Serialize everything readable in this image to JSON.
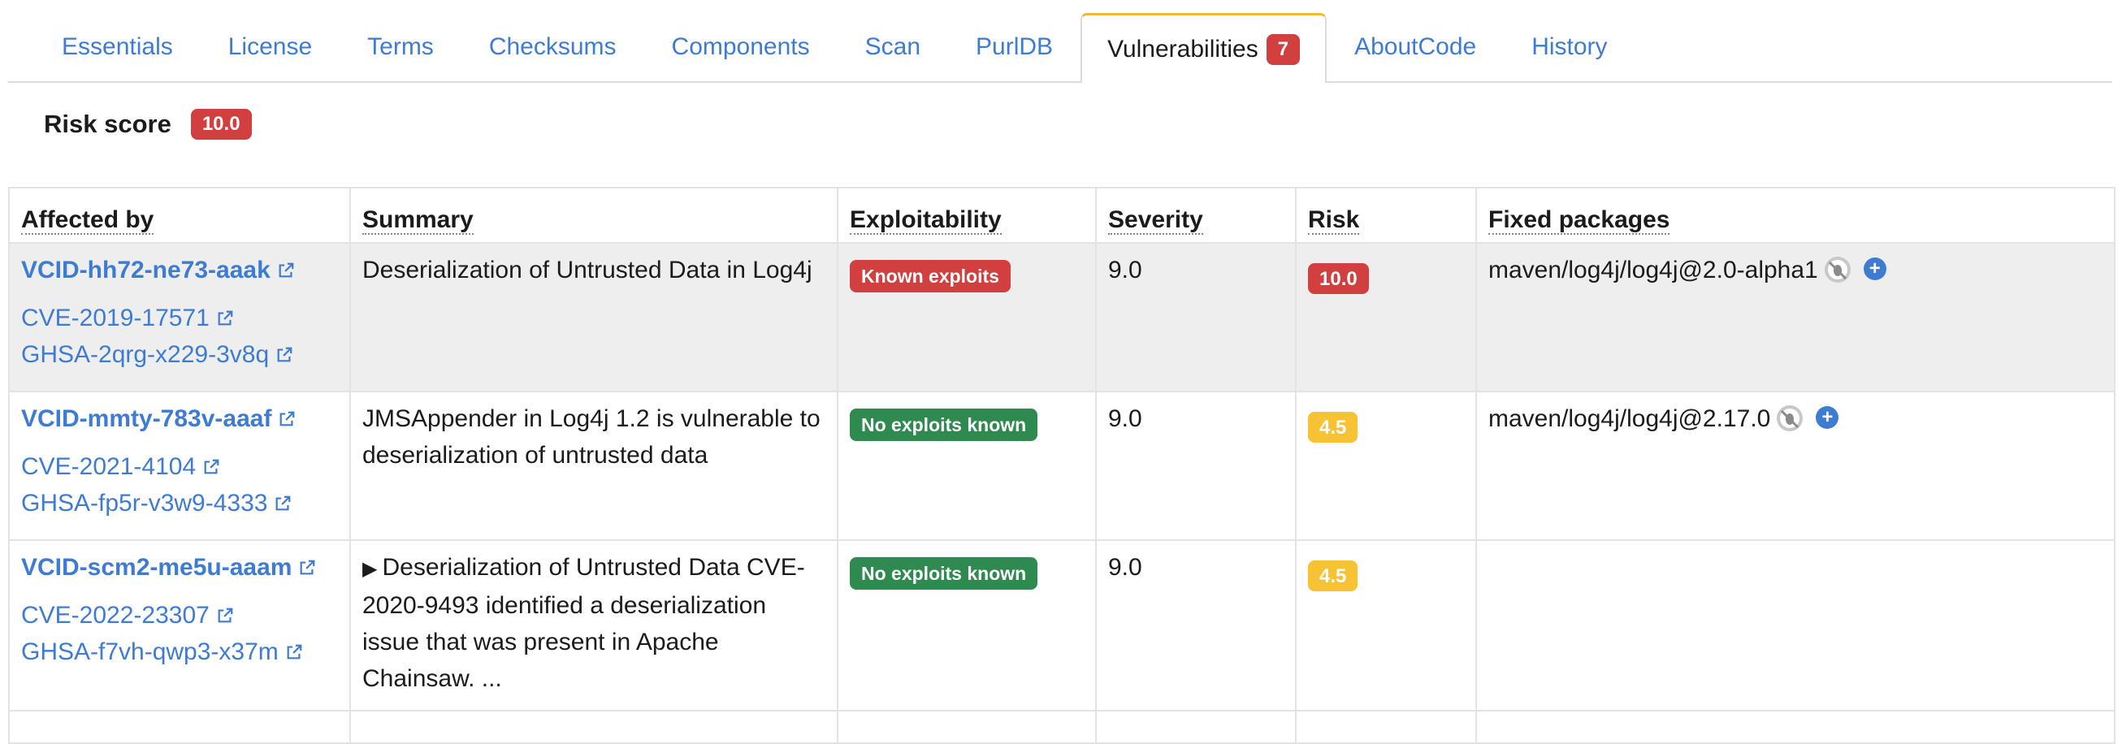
{
  "tabs": [
    {
      "label": "Essentials"
    },
    {
      "label": "License"
    },
    {
      "label": "Terms"
    },
    {
      "label": "Checksums"
    },
    {
      "label": "Components"
    },
    {
      "label": "Scan"
    },
    {
      "label": "PurlDB"
    },
    {
      "label": "Vulnerabilities",
      "badge": "7",
      "active": true
    },
    {
      "label": "AboutCode"
    },
    {
      "label": "History"
    }
  ],
  "risk_score": {
    "label": "Risk score",
    "value": "10.0"
  },
  "table": {
    "headers": [
      "Affected by",
      "Summary",
      "Exploitability",
      "Severity",
      "Risk",
      "Fixed packages"
    ],
    "rows": [
      {
        "vcid": "VCID-hh72-ne73-aaak",
        "aliases": [
          "CVE-2019-17571",
          "GHSA-2qrg-x229-3v8q"
        ],
        "summary": "Deserialization of Untrusted Data in Log4j",
        "exploitability": "Known exploits",
        "severity": "9.0",
        "risk": "10.0",
        "fixed": "maven/log4j/log4j@2.0-alpha1"
      },
      {
        "vcid": "VCID-mmty-783v-aaaf",
        "aliases": [
          "CVE-2021-4104",
          "GHSA-fp5r-v3w9-4333"
        ],
        "summary": "JMSAppender in Log4j 1.2 is vulnerable to deserialization of untrusted data",
        "exploitability": "No exploits known",
        "severity": "9.0",
        "risk": "4.5",
        "fixed": "maven/log4j/log4j@2.17.0"
      },
      {
        "vcid": "VCID-scm2-me5u-aaam",
        "aliases": [
          "CVE-2022-23307",
          "GHSA-f7vh-qwp3-x37m"
        ],
        "summary": "Deserialization of Untrusted Data CVE-2020-9493 identified a deserialization issue that was present in Apache Chainsaw. ...",
        "exploitability": "No exploits known",
        "severity": "9.0",
        "risk": "4.5",
        "fixed": ""
      }
    ]
  },
  "colors": {
    "link": "#3e7bd2",
    "danger": "#d13f3f",
    "warning": "#f7c233",
    "success": "#2f8a4f",
    "active_tab_accent": "#f3b83a"
  },
  "icons": [
    "external-link-icon",
    "bug-slash-icon",
    "plus-circle-icon",
    "triangle-right-icon"
  ]
}
